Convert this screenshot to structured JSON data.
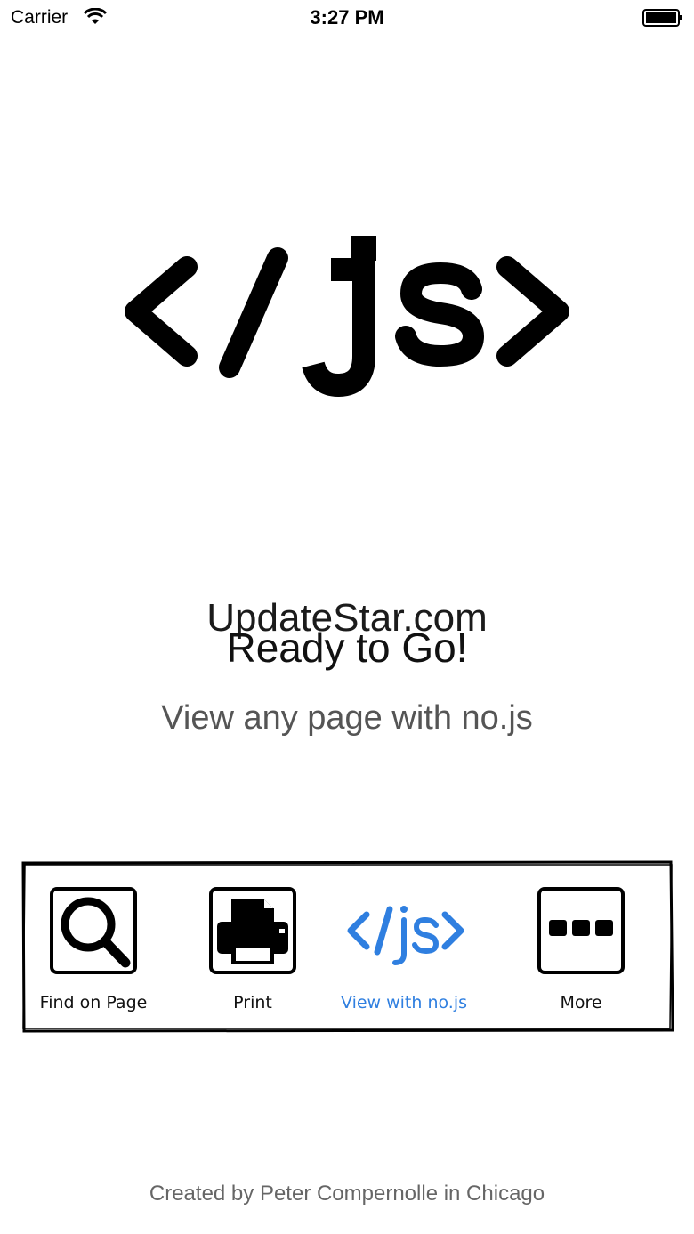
{
  "status_bar": {
    "carrier": "Carrier",
    "time": "3:27 PM"
  },
  "logo": {
    "text": "</js>"
  },
  "watermark": "UpdateStar.com",
  "hero": {
    "title": "Ready to Go!",
    "subtitle": "View any page with no.js"
  },
  "toolbar": {
    "items": [
      {
        "label": "Find on Page",
        "icon": "magnifier-icon"
      },
      {
        "label": "Print",
        "icon": "printer-icon"
      },
      {
        "label": "View with no.js",
        "icon": "nojs-icon"
      },
      {
        "label": "More",
        "icon": "more-dots-icon"
      }
    ]
  },
  "footer": "Created by Peter Compernolle in Chicago",
  "colors": {
    "accent": "#2f7fe0",
    "text": "#000000",
    "muted": "#555555"
  }
}
